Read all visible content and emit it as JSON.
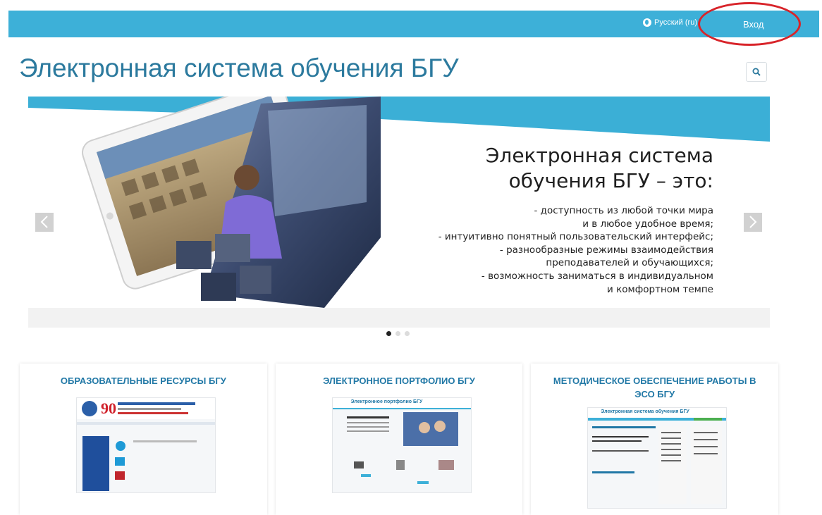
{
  "header": {
    "language": "Русский (ru)",
    "login_label": "Вход"
  },
  "site": {
    "title": "Электронная система обучения БГУ"
  },
  "slider": {
    "heading": "Электронная система\nобучения БГУ – это:",
    "items": [
      "- доступность из любой точки мира",
      "и в любое удобное время;",
      "- интуитивно понятный пользовательский интерфейс;",
      "- разнообразные режимы взаимодействия",
      "преподавателей и обучающихся;",
      "- возможность заниматься в индивидуальном",
      "и комфортном темпе"
    ],
    "slide_count": 3,
    "active_slide": 1
  },
  "cards": [
    {
      "title": "ОБРАЗОВАТЕЛЬНЫЕ РЕСУРСЫ БГУ",
      "thumb_caption": "90"
    },
    {
      "title": "ЭЛЕКТРОННОЕ ПОРТФОЛИО БГУ",
      "thumb_caption": "Электронное портфолио БГУ"
    },
    {
      "title": "МЕТОДИЧЕСКОЕ ОБЕСПЕЧЕНИЕ РАБОТЫ В ЭСО БГУ",
      "thumb_caption": "Электронная система обучения БГУ"
    }
  ],
  "colors": {
    "topbar": "#3db0d8",
    "title": "#2c7a9e",
    "card_title": "#2178a6",
    "highlight_circle": "#d8242a"
  }
}
